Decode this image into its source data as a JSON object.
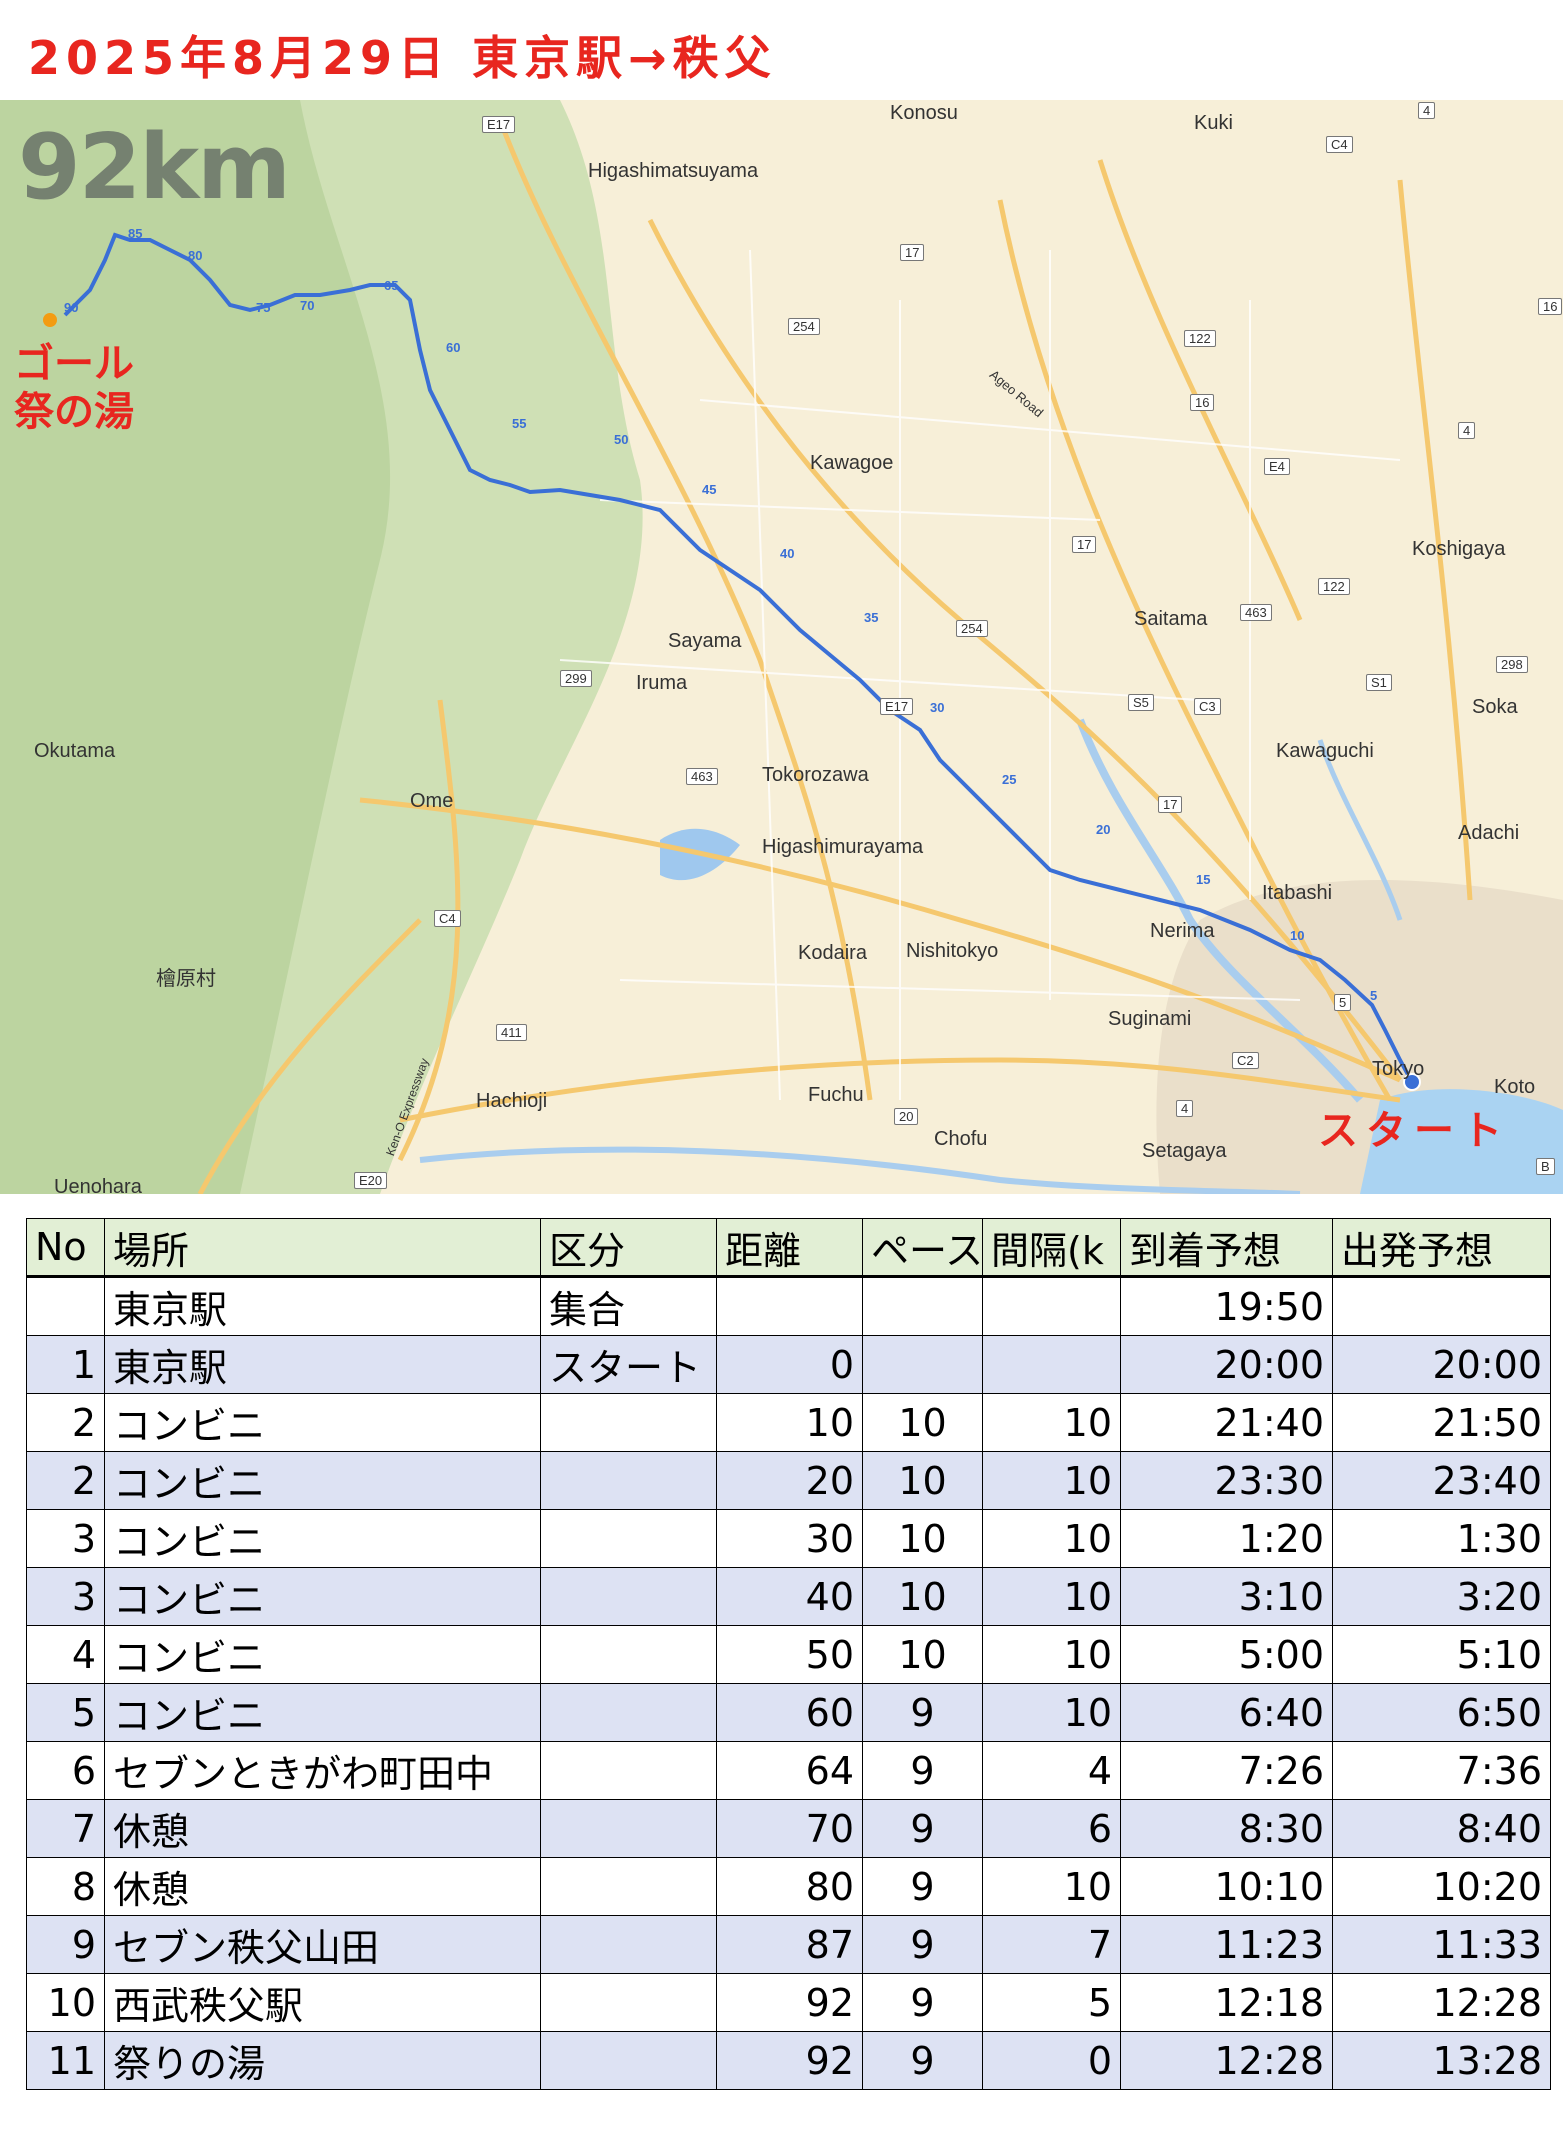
{
  "header": {
    "title": "2025年8月29日 東京駅→秩父"
  },
  "map": {
    "distance_label": "92km",
    "goal_label_line1": "ゴール",
    "goal_label_line2": "祭の湯",
    "start_label": "スタート",
    "cities": {
      "konosu": "Konosu",
      "kuki": "Kuki",
      "higashimatsuyama": "Higashimatsuyama",
      "kawagoe": "Kawagoe",
      "koshigaya": "Koshigaya",
      "saitama": "Saitama",
      "sayama": "Sayama",
      "iruma": "Iruma",
      "soka": "Soka",
      "kawaguchi": "Kawaguchi",
      "okutama": "Okutama",
      "tokorozawa": "Tokorozawa",
      "ome": "Ome",
      "adachi": "Adachi",
      "higashimurayama": "Higashimurayama",
      "itabashi": "Itabashi",
      "nerima": "Nerima",
      "kodaira": "Kodaira",
      "nishitokyo": "Nishitokyo",
      "hinoharamura": "檜原村",
      "suginami": "Suginami",
      "tokyo": "Tokyo",
      "koto": "Koto",
      "hachioji": "Hachioji",
      "fuchu": "Fuchu",
      "chofu": "Chofu",
      "setagaya": "Setagaya",
      "uenohara": "Uenohara",
      "ageo_road": "Ageo Road",
      "ken_o": "Ken-O Expressway"
    },
    "shields": [
      "E17",
      "C4",
      "4",
      "17",
      "254",
      "122",
      "16",
      "4",
      "E4",
      "17",
      "463",
      "122",
      "298",
      "S1",
      "254",
      "299",
      "E17",
      "S5",
      "C3",
      "463",
      "17",
      "C4",
      "5",
      "411",
      "C2",
      "4",
      "20",
      "E20",
      "B",
      "16"
    ],
    "route_markers": [
      "5",
      "10",
      "15",
      "20",
      "25",
      "30",
      "35",
      "40",
      "45",
      "50",
      "55",
      "60",
      "65",
      "70",
      "75",
      "80",
      "85",
      "90"
    ]
  },
  "table": {
    "headers": [
      "No",
      "場所",
      "区分",
      "距離",
      "ペース",
      "間隔(k",
      "到着予想",
      "出発予想"
    ],
    "rows": [
      [
        "",
        "東京駅",
        "集合",
        "",
        "",
        "",
        "19:50",
        ""
      ],
      [
        "1",
        "東京駅",
        "スタート",
        "0",
        "",
        "",
        "20:00",
        "20:00"
      ],
      [
        "2",
        "コンビニ",
        "",
        "10",
        "10",
        "10",
        "21:40",
        "21:50"
      ],
      [
        "2",
        "コンビニ",
        "",
        "20",
        "10",
        "10",
        "23:30",
        "23:40"
      ],
      [
        "3",
        "コンビニ",
        "",
        "30",
        "10",
        "10",
        "1:20",
        "1:30"
      ],
      [
        "3",
        "コンビニ",
        "",
        "40",
        "10",
        "10",
        "3:10",
        "3:20"
      ],
      [
        "4",
        "コンビニ",
        "",
        "50",
        "10",
        "10",
        "5:00",
        "5:10"
      ],
      [
        "5",
        "コンビニ",
        "",
        "60",
        "9",
        "10",
        "6:40",
        "6:50"
      ],
      [
        "6",
        "セブンときがわ町田中",
        "",
        "64",
        "9",
        "4",
        "7:26",
        "7:36"
      ],
      [
        "7",
        "休憩",
        "",
        "70",
        "9",
        "6",
        "8:30",
        "8:40"
      ],
      [
        "8",
        "休憩",
        "",
        "80",
        "9",
        "10",
        "10:10",
        "10:20"
      ],
      [
        "9",
        "セブン秩父山田",
        "",
        "87",
        "9",
        "7",
        "11:23",
        "11:33"
      ],
      [
        "10",
        "西武秩父駅",
        "",
        "92",
        "9",
        "5",
        "12:18",
        "12:28"
      ],
      [
        "11",
        "祭りの湯",
        "",
        "92",
        "9",
        "0",
        "12:28",
        "13:28"
      ]
    ]
  },
  "colors": {
    "title_red": "#e8261f",
    "route_blue": "#3a6fd6",
    "header_green": "#e2efd5",
    "row_blue": "#dde2f3"
  }
}
